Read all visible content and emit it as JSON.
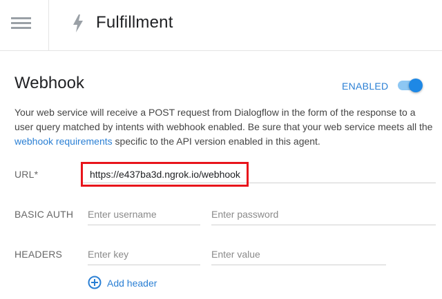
{
  "header": {
    "title": "Fulfillment",
    "menu_icon": "hamburger-menu-icon",
    "section_icon": "lightning-bolt-icon"
  },
  "webhook": {
    "title": "Webhook",
    "status_label": "ENABLED",
    "toggle_on": true,
    "description_part1": "Your web service will receive a POST request from Dialogflow in the form of the response to a user query matched by intents with webhook enabled. Be sure that your web service meets all the ",
    "description_link": "webhook requirements",
    "description_part2": " specific to the API version enabled in this agent.",
    "url_label": "URL*",
    "url_value": "https://e437ba3d.ngrok.io/webhook",
    "basic_auth_label": "BASIC AUTH",
    "username_placeholder": "Enter username",
    "password_placeholder": "Enter password",
    "headers_label": "HEADERS",
    "key_placeholder": "Enter key",
    "value_placeholder": "Enter value",
    "add_header_label": "Add header"
  },
  "colors": {
    "accent": "#2a7fd4",
    "toggle_track": "#8dc7f3",
    "toggle_thumb": "#1e88e5",
    "highlight_box": "#e8141b"
  }
}
